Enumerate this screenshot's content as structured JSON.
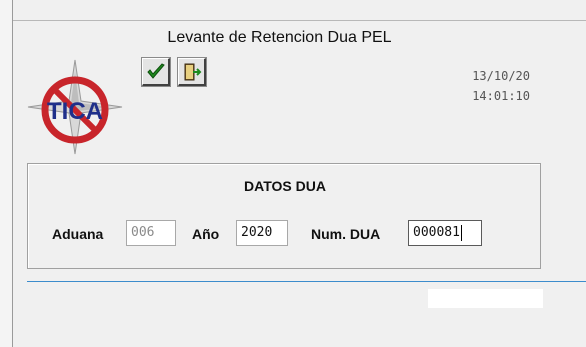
{
  "window": {
    "title": "Levante de Retencion Dua PEL"
  },
  "logo": {
    "text": "TICA"
  },
  "toolbar": {
    "accept_icon": "checkmark-icon",
    "exit_icon": "exit-door-icon"
  },
  "datetime": {
    "date": "13/10/20",
    "time": "14:01:10"
  },
  "datos_dua": {
    "title": "DATOS DUA",
    "aduana_label": "Aduana",
    "aduana_value": "006",
    "anio_label": "Año",
    "anio_value": "2020",
    "num_dua_label": "Num. DUA",
    "num_dua_value": "000081"
  },
  "colors": {
    "separator": "#3c8ccc",
    "logo_red": "#c8252b",
    "check_green": "#1f8a1f"
  }
}
